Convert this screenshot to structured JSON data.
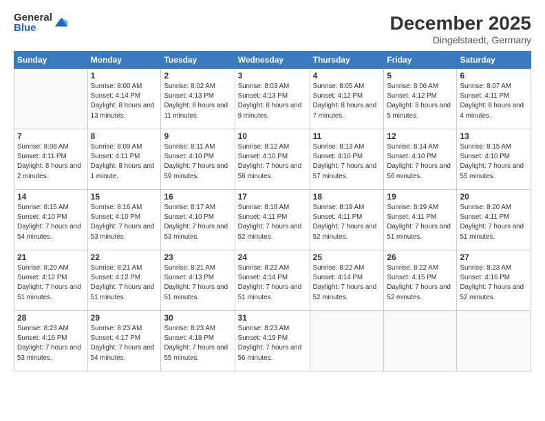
{
  "logo": {
    "general": "General",
    "blue": "Blue"
  },
  "header": {
    "month_year": "December 2025",
    "location": "Dingelstaedt, Germany"
  },
  "days_of_week": [
    "Sunday",
    "Monday",
    "Tuesday",
    "Wednesday",
    "Thursday",
    "Friday",
    "Saturday"
  ],
  "weeks": [
    [
      {
        "day": "",
        "info": ""
      },
      {
        "day": "1",
        "info": "Sunrise: 8:00 AM\nSunset: 4:14 PM\nDaylight: 8 hours\nand 13 minutes."
      },
      {
        "day": "2",
        "info": "Sunrise: 8:02 AM\nSunset: 4:13 PM\nDaylight: 8 hours\nand 11 minutes."
      },
      {
        "day": "3",
        "info": "Sunrise: 8:03 AM\nSunset: 4:13 PM\nDaylight: 8 hours\nand 9 minutes."
      },
      {
        "day": "4",
        "info": "Sunrise: 8:05 AM\nSunset: 4:12 PM\nDaylight: 8 hours\nand 7 minutes."
      },
      {
        "day": "5",
        "info": "Sunrise: 8:06 AM\nSunset: 4:12 PM\nDaylight: 8 hours\nand 5 minutes."
      },
      {
        "day": "6",
        "info": "Sunrise: 8:07 AM\nSunset: 4:11 PM\nDaylight: 8 hours\nand 4 minutes."
      }
    ],
    [
      {
        "day": "7",
        "info": "Sunrise: 8:08 AM\nSunset: 4:11 PM\nDaylight: 8 hours\nand 2 minutes."
      },
      {
        "day": "8",
        "info": "Sunrise: 8:09 AM\nSunset: 4:11 PM\nDaylight: 8 hours\nand 1 minute."
      },
      {
        "day": "9",
        "info": "Sunrise: 8:11 AM\nSunset: 4:10 PM\nDaylight: 7 hours\nand 59 minutes."
      },
      {
        "day": "10",
        "info": "Sunrise: 8:12 AM\nSunset: 4:10 PM\nDaylight: 7 hours\nand 58 minutes."
      },
      {
        "day": "11",
        "info": "Sunrise: 8:13 AM\nSunset: 4:10 PM\nDaylight: 7 hours\nand 57 minutes."
      },
      {
        "day": "12",
        "info": "Sunrise: 8:14 AM\nSunset: 4:10 PM\nDaylight: 7 hours\nand 56 minutes."
      },
      {
        "day": "13",
        "info": "Sunrise: 8:15 AM\nSunset: 4:10 PM\nDaylight: 7 hours\nand 55 minutes."
      }
    ],
    [
      {
        "day": "14",
        "info": "Sunrise: 8:15 AM\nSunset: 4:10 PM\nDaylight: 7 hours\nand 54 minutes."
      },
      {
        "day": "15",
        "info": "Sunrise: 8:16 AM\nSunset: 4:10 PM\nDaylight: 7 hours\nand 53 minutes."
      },
      {
        "day": "16",
        "info": "Sunrise: 8:17 AM\nSunset: 4:10 PM\nDaylight: 7 hours\nand 53 minutes."
      },
      {
        "day": "17",
        "info": "Sunrise: 8:18 AM\nSunset: 4:11 PM\nDaylight: 7 hours\nand 52 minutes."
      },
      {
        "day": "18",
        "info": "Sunrise: 8:19 AM\nSunset: 4:11 PM\nDaylight: 7 hours\nand 52 minutes."
      },
      {
        "day": "19",
        "info": "Sunrise: 8:19 AM\nSunset: 4:11 PM\nDaylight: 7 hours\nand 51 minutes."
      },
      {
        "day": "20",
        "info": "Sunrise: 8:20 AM\nSunset: 4:11 PM\nDaylight: 7 hours\nand 51 minutes."
      }
    ],
    [
      {
        "day": "21",
        "info": "Sunrise: 8:20 AM\nSunset: 4:12 PM\nDaylight: 7 hours\nand 51 minutes."
      },
      {
        "day": "22",
        "info": "Sunrise: 8:21 AM\nSunset: 4:12 PM\nDaylight: 7 hours\nand 51 minutes."
      },
      {
        "day": "23",
        "info": "Sunrise: 8:21 AM\nSunset: 4:13 PM\nDaylight: 7 hours\nand 51 minutes."
      },
      {
        "day": "24",
        "info": "Sunrise: 8:22 AM\nSunset: 4:14 PM\nDaylight: 7 hours\nand 51 minutes."
      },
      {
        "day": "25",
        "info": "Sunrise: 8:22 AM\nSunset: 4:14 PM\nDaylight: 7 hours\nand 52 minutes."
      },
      {
        "day": "26",
        "info": "Sunrise: 8:22 AM\nSunset: 4:15 PM\nDaylight: 7 hours\nand 52 minutes."
      },
      {
        "day": "27",
        "info": "Sunrise: 8:23 AM\nSunset: 4:16 PM\nDaylight: 7 hours\nand 52 minutes."
      }
    ],
    [
      {
        "day": "28",
        "info": "Sunrise: 8:23 AM\nSunset: 4:16 PM\nDaylight: 7 hours\nand 53 minutes."
      },
      {
        "day": "29",
        "info": "Sunrise: 8:23 AM\nSunset: 4:17 PM\nDaylight: 7 hours\nand 54 minutes."
      },
      {
        "day": "30",
        "info": "Sunrise: 8:23 AM\nSunset: 4:18 PM\nDaylight: 7 hours\nand 55 minutes."
      },
      {
        "day": "31",
        "info": "Sunrise: 8:23 AM\nSunset: 4:19 PM\nDaylight: 7 hours\nand 56 minutes."
      },
      {
        "day": "",
        "info": ""
      },
      {
        "day": "",
        "info": ""
      },
      {
        "day": "",
        "info": ""
      }
    ]
  ]
}
